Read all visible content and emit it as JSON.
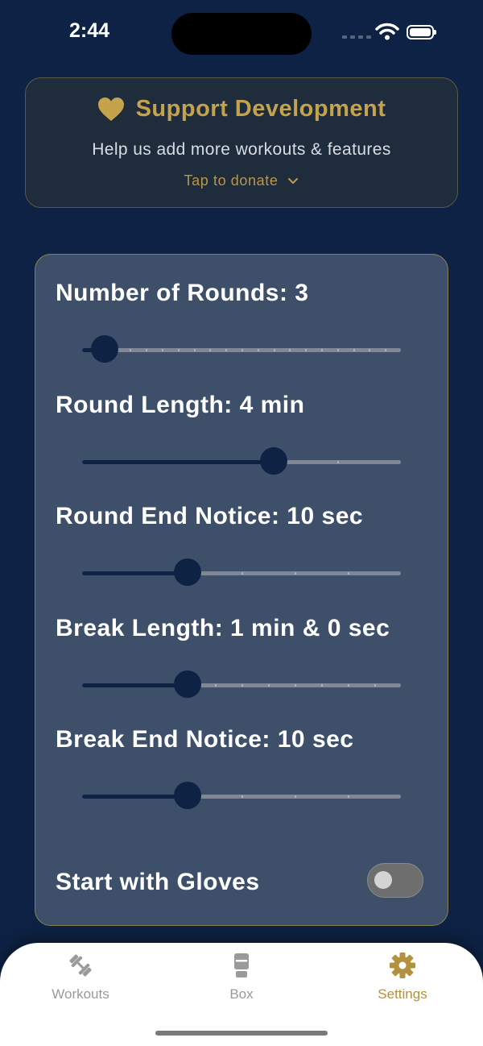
{
  "status_bar": {
    "time": "2:44"
  },
  "donate": {
    "title": "Support Development",
    "subtitle": "Help us add more workouts & features",
    "cta": "Tap to donate"
  },
  "settings": {
    "rounds": {
      "label": "Number of Rounds: 3",
      "value_fraction": 0.07,
      "ticks": 20
    },
    "round_length": {
      "label": "Round Length: 4 min",
      "value_fraction": 0.6,
      "ticks": 5
    },
    "round_end_notice": {
      "label": "Round End Notice: 10 sec",
      "value_fraction": 0.33,
      "ticks": 6
    },
    "break_length": {
      "label": "Break Length: 1 min & 0 sec",
      "value_fraction": 0.33,
      "ticks": 12
    },
    "break_end_notice": {
      "label": "Break End Notice: 10 sec",
      "value_fraction": 0.33,
      "ticks": 6
    },
    "gloves": {
      "label": "Start with Gloves",
      "on": false
    }
  },
  "tabs": [
    {
      "label": "Workouts",
      "icon": "dumbbell-icon",
      "active": false
    },
    {
      "label": "Box",
      "icon": "boxing-glove-icon",
      "active": false
    },
    {
      "label": "Settings",
      "icon": "gear-icon",
      "active": true
    }
  ],
  "colors": {
    "accent": "#c5a24c",
    "background": "#0d2244",
    "card": "#3e5069"
  }
}
